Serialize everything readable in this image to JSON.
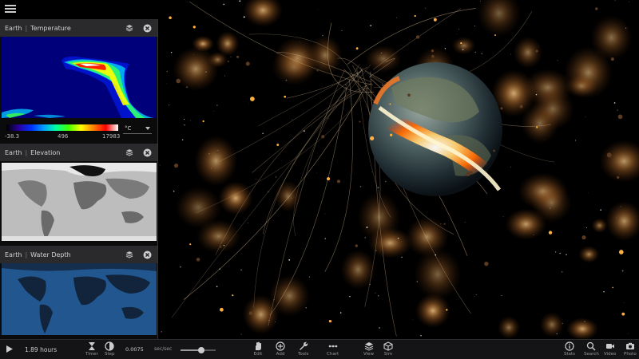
{
  "panels": [
    {
      "planet": "Earth",
      "layer": "Temperature"
    },
    {
      "planet": "Earth",
      "layer": "Elevation"
    },
    {
      "planet": "Earth",
      "layer": "Water Depth"
    }
  ],
  "colorbar": {
    "min": "-38.3",
    "mid": "496",
    "max": "17983",
    "unit": "°C"
  },
  "controls": {
    "duration": "1.89 hours",
    "timer_label": "Timer",
    "step_label": "Step",
    "rate_value": "0.0075",
    "rate_unit": "sec/sec",
    "rate_slider_level": 0.6
  },
  "toolbar": [
    {
      "label": "Edit",
      "icon": "hand-icon"
    },
    {
      "label": "Add",
      "icon": "plus-circle-icon"
    },
    {
      "label": "Tools",
      "icon": "wrench-icon"
    },
    {
      "label": "Chart",
      "icon": "chart-icon"
    },
    {
      "label": "View",
      "icon": "layers-icon"
    },
    {
      "label": "Sim",
      "icon": "cube-icon"
    }
  ],
  "right_toolbar": [
    {
      "label": "Stats",
      "icon": "info-icon"
    },
    {
      "label": "Search",
      "icon": "search-icon"
    },
    {
      "label": "Video",
      "icon": "video-icon"
    },
    {
      "label": "Photo",
      "icon": "camera-icon"
    }
  ]
}
